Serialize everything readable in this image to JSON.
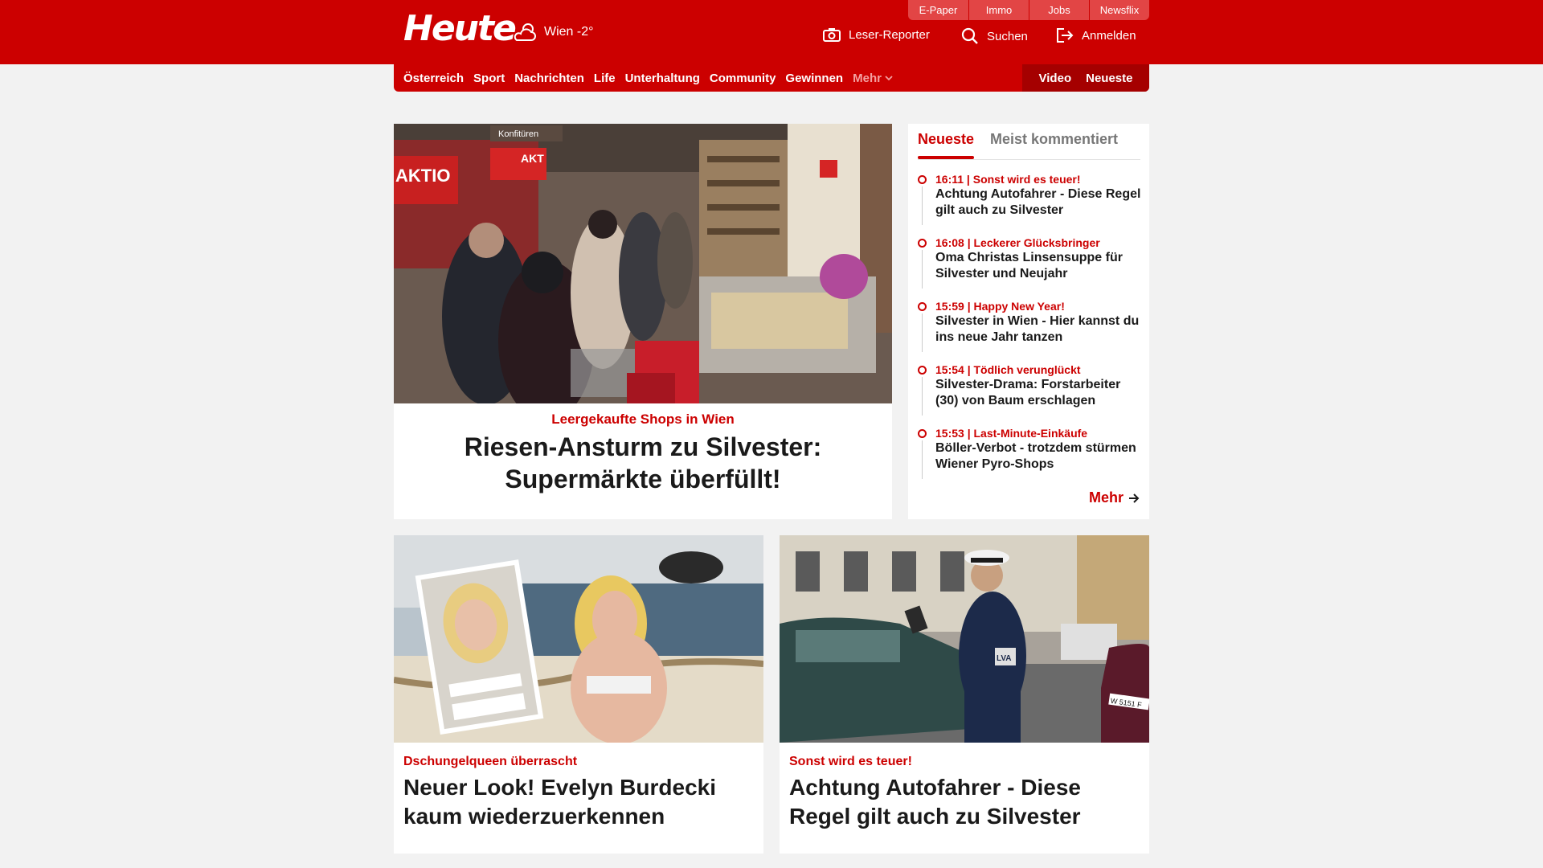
{
  "topbar": {
    "top_links": [
      "E-Paper",
      "Immo",
      "Jobs",
      "Newsflix"
    ],
    "logo": "Heute",
    "weather_icon": "cloud-sun-icon",
    "weather": "Wien -2°",
    "tools": {
      "reporter": "Leser-Reporter",
      "search": "Suchen",
      "login": "Anmelden"
    }
  },
  "nav": {
    "items": [
      "Österreich",
      "Sport",
      "Nachrichten",
      "Life",
      "Unterhaltung",
      "Community",
      "Gewinnen"
    ],
    "more": "Mehr",
    "right": [
      "Video",
      "Neueste"
    ]
  },
  "hero": {
    "kicker": "Leergekaufte Shops in Wien",
    "title": "Riesen-Ansturm zu Silvester: Supermärkte überfüllt!",
    "image_texts": {
      "sign1": "Konfitüren",
      "sign2": "AKTIO",
      "sign3": "AKT"
    }
  },
  "sidebar": {
    "tabs": [
      "Neueste",
      "Meist kommentiert"
    ],
    "news": [
      {
        "meta": "16:11 | Sonst wird es teuer!",
        "headline": "Achtung Autofahrer - Diese Regel gilt auch zu Silvester"
      },
      {
        "meta": "16:08 | Leckerer Glücksbringer",
        "headline": "Oma Christas Linsensuppe für Silvester und Neujahr"
      },
      {
        "meta": "15:59 | Happy New Year!",
        "headline": "Silvester in Wien - Hier kannst du ins neue Jahr tanzen"
      },
      {
        "meta": "15:54 | Tödlich verunglückt",
        "headline": "Silvester-Drama: Forstarbeiter (30) von Baum erschlagen"
      },
      {
        "meta": "15:53 | Last-Minute-Einkäufe",
        "headline": "Böller-Verbot - trotzdem stürmen Wiener Pyro-Shops"
      }
    ],
    "more": "Mehr"
  },
  "cards": [
    {
      "kicker": "Dschungelqueen überrascht",
      "title": "Neuer Look! Evelyn Burdecki kaum wiederzuerkennen"
    },
    {
      "kicker": "Sonst wird es teuer!",
      "title": "Achtung Autofahrer - Diese Regel gilt auch zu Silvester",
      "image_texts": {
        "badge": "LVA",
        "plate": "W 5151 F"
      }
    }
  ],
  "colors": {
    "brand": "#cc0000",
    "background": "#f2f2f2"
  }
}
